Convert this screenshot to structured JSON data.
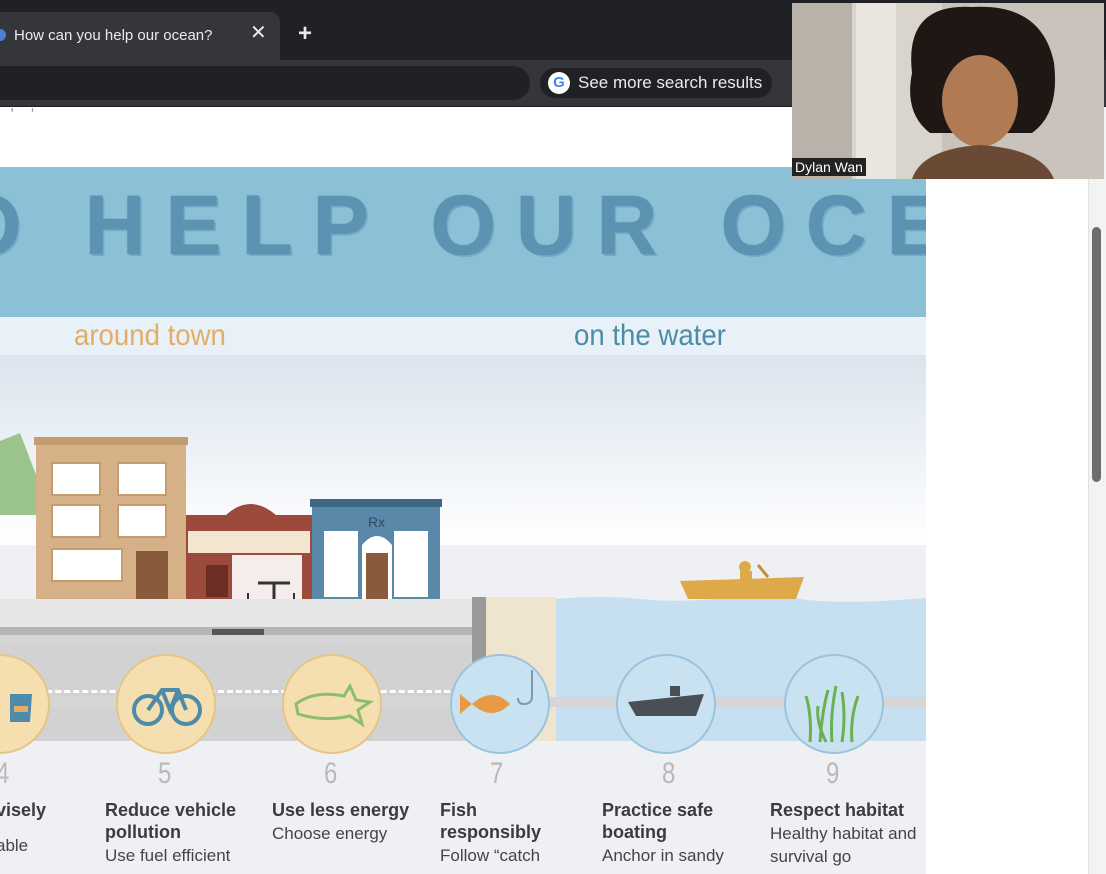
{
  "browser": {
    "tab_title": "How can you help our ocean?",
    "tab_close": "✕",
    "new_tab": "+",
    "search_chip_label": "See more search results"
  },
  "page": {
    "cut_text": ", ,"
  },
  "infographic": {
    "banner_title": "O HELP OUR OCEAN",
    "sections": {
      "around_town": "around town",
      "on_the_water": "on the water"
    },
    "store_sign": "Rx",
    "steps": [
      {
        "number": "4",
        "title": "visely",
        "desc": "able"
      },
      {
        "number": "5",
        "title": "Reduce vehicle pollution",
        "desc": "Use fuel efficient"
      },
      {
        "number": "6",
        "title": "Use less energy",
        "desc": "Choose energy"
      },
      {
        "number": "7",
        "title": "Fish responsibly",
        "desc": "Follow “catch"
      },
      {
        "number": "8",
        "title": "Practice safe boating",
        "desc": "Anchor in sandy"
      },
      {
        "number": "9",
        "title": "Respect habitat",
        "desc": "Healthy habitat and survival go"
      }
    ],
    "icons": [
      "bag-icon",
      "bicycle-icon",
      "energy-star-icon",
      "fish-hook-icon",
      "boat-icon",
      "seagrass-icon"
    ],
    "colors": {
      "banner": "#8bc0d6",
      "title": "#5c93b3",
      "around_town": "#e3ad66",
      "on_the_water": "#4c8ca8",
      "water": "#c6e0f2"
    }
  },
  "video_call": {
    "participant_name": "Dylan Wan"
  }
}
